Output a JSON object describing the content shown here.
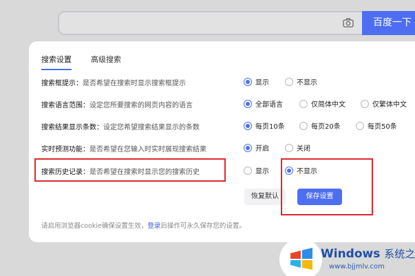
{
  "search": {
    "button_label": "百度一下",
    "camera_icon": "camera-icon"
  },
  "tabs": [
    {
      "label": "搜索设置"
    },
    {
      "label": "高级搜索"
    }
  ],
  "settings": [
    {
      "key": "搜索框提示：",
      "desc": "是否希望在搜索时显示搜索框提示",
      "options": [
        "显示",
        "不显示"
      ],
      "selected": 0
    },
    {
      "key": "搜索语言范围：",
      "desc": "设定您所要搜索的网页内容的语言",
      "options": [
        "全部语言",
        "仅简体中文",
        "仅繁体中文"
      ],
      "selected": 0
    },
    {
      "key": "搜索结果显示条数：",
      "desc": "设定您希望搜索结果显示的条数",
      "options": [
        "每页10条",
        "每页20条",
        "每页50条"
      ],
      "selected": 0
    },
    {
      "key": "实时预测功能：",
      "desc": "是否希望在您输入时实时展现搜索结果",
      "options": [
        "开启",
        "关闭"
      ],
      "selected": 0
    },
    {
      "key": "搜索历史记录：",
      "desc": "是否希望在搜索时显示您的搜索历史",
      "options": [
        "显示",
        "不显示"
      ],
      "selected": 1
    }
  ],
  "buttons": {
    "restore": "恢复默认",
    "save": "保存设置"
  },
  "footer": {
    "prefix": "请启用浏览器cookie确保设置生效，",
    "link": "登录",
    "suffix": "后操作可永久保存您的设置。"
  },
  "watermark": {
    "title": "Windows",
    "title_cn": "系统之家",
    "url": "www.bjjmlv.com"
  },
  "colors": {
    "accent": "#4e6ef2",
    "highlight": "#e0262b"
  }
}
